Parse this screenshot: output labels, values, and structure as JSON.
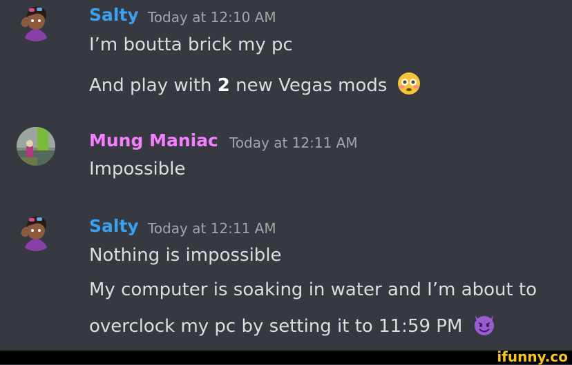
{
  "colors": {
    "background": "#36393f",
    "salty_name": "#3aa0f0",
    "mung_name": "#f47fff",
    "message_text": "#dcddde",
    "timestamp": "#a3a6aa",
    "watermark": "#f7c51e"
  },
  "messages": [
    {
      "author": "Salty",
      "avatar_icon": "cartoon-avatar-icon",
      "timestamp": "Today at 12:10 AM",
      "lines": [
        {
          "text": "I’m boutta brick my pc"
        },
        {
          "pre": "And play with ",
          "bold": "2",
          "post": " new Vegas mods",
          "emoji": "flushed-face-emoji"
        }
      ]
    },
    {
      "author": "Mung Maniac",
      "avatar_icon": "photo-avatar-icon",
      "timestamp": "Today at 12:11 AM",
      "lines": [
        {
          "text": "Impossible"
        }
      ]
    },
    {
      "author": "Salty",
      "avatar_icon": "cartoon-avatar-icon",
      "timestamp": "Today at 12:11 AM",
      "lines": [
        {
          "text": "Nothing is impossible"
        },
        {
          "text": "My computer is soaking in water and I’m about to"
        },
        {
          "text": "overclock my pc by setting it to 11:59 PM",
          "emoji": "smiling-imp-emoji"
        }
      ]
    }
  ],
  "watermark": "ifunny.co"
}
